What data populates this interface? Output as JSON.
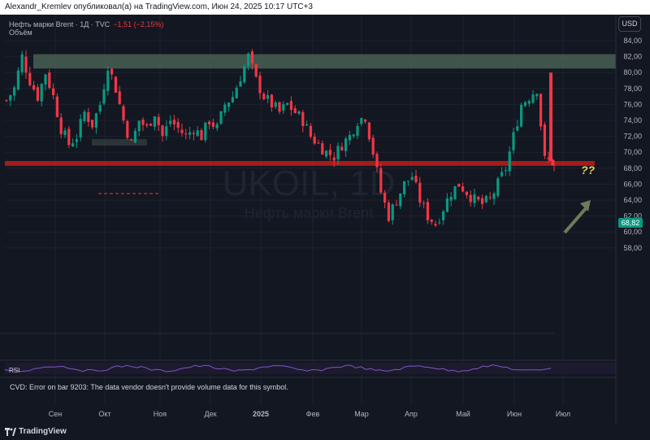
{
  "header": {
    "text": "Alexandr_Kremlev опубликовал(а) на TradingView.com, Июн 24, 2025 10:17 UTC+3"
  },
  "legend": {
    "symbol": "Нефть марки Brent · 1Д · TVC",
    "change": "−1,51 (−2,15%)",
    "volume_label": "Объём"
  },
  "currency": "USD",
  "last_price": "68,82",
  "watermark": {
    "ticker": "UKOIL, 1D",
    "name": "Нефть марки Brent"
  },
  "rsi_label": "RSI",
  "cvd_error": "CVD: Error on bar 9203: The data vendor doesn't provide volume data for this symbol.",
  "annotation": "??",
  "footer": {
    "brand": "TradingView"
  },
  "colors": {
    "up": "#089981",
    "down": "#f23645",
    "zone_top": "#4f6a58",
    "zone_bottom": "#b71c1c",
    "rsi": "#7e57c2",
    "annotation": "#e8d44d"
  },
  "chart_data": {
    "type": "candlestick",
    "y_ticks": [
      "84,00",
      "82,00",
      "80,00",
      "78,00",
      "76,00",
      "74,00",
      "72,00",
      "70,00",
      "68,00",
      "66,00",
      "64,00",
      "62,00",
      "60,00",
      "58,00"
    ],
    "x_ticks": [
      "Сен",
      "Окт",
      "Ноя",
      "Дек",
      "2025",
      "Фев",
      "Мар",
      "Апр",
      "Май",
      "Июн",
      "Июл"
    ],
    "ylim": [
      57,
      85
    ],
    "resistance_zone": [
      80.5,
      82.3
    ],
    "support_zone": [
      68.3,
      68.9
    ],
    "close_path": [
      [
        0,
        76.5
      ],
      [
        2,
        78
      ],
      [
        4,
        82
      ],
      [
        6,
        79
      ],
      [
        8,
        77
      ],
      [
        10,
        80
      ],
      [
        12,
        77
      ],
      [
        14,
        73
      ],
      [
        16,
        71
      ],
      [
        18,
        72
      ],
      [
        20,
        75
      ],
      [
        22,
        73.5
      ],
      [
        24,
        76
      ],
      [
        26,
        81
      ],
      [
        28,
        78
      ],
      [
        30,
        74
      ],
      [
        32,
        71
      ],
      [
        34,
        74
      ],
      [
        36,
        73
      ],
      [
        38,
        75
      ],
      [
        40,
        72
      ],
      [
        42,
        74
      ],
      [
        44,
        73
      ],
      [
        46,
        72
      ],
      [
        48,
        73
      ],
      [
        50,
        72
      ],
      [
        52,
        74
      ],
      [
        54,
        73
      ],
      [
        56,
        76
      ],
      [
        58,
        77
      ],
      [
        60,
        79.5
      ],
      [
        62,
        82
      ],
      [
        64,
        79
      ],
      [
        66,
        77
      ],
      [
        68,
        76
      ],
      [
        70,
        75
      ],
      [
        72,
        76
      ],
      [
        74,
        75
      ],
      [
        76,
        74
      ],
      [
        78,
        72
      ],
      [
        80,
        71
      ],
      [
        82,
        70
      ],
      [
        84,
        69.5
      ],
      [
        86,
        71
      ],
      [
        88,
        72
      ],
      [
        90,
        74
      ],
      [
        92,
        74.5
      ],
      [
        94,
        70
      ],
      [
        96,
        65
      ],
      [
        98,
        62
      ],
      [
        100,
        64
      ],
      [
        102,
        66
      ],
      [
        104,
        67
      ],
      [
        106,
        64
      ],
      [
        108,
        62
      ],
      [
        110,
        61
      ],
      [
        112,
        63
      ],
      [
        114,
        65
      ],
      [
        116,
        66
      ],
      [
        118,
        65
      ],
      [
        120,
        64
      ],
      [
        122,
        63.5
      ],
      [
        124,
        64
      ],
      [
        126,
        66
      ],
      [
        128,
        68
      ],
      [
        130,
        72
      ],
      [
        132,
        76
      ],
      [
        134,
        77
      ],
      [
        136,
        78
      ],
      [
        138,
        69
      ],
      [
        140,
        68.8
      ]
    ]
  }
}
